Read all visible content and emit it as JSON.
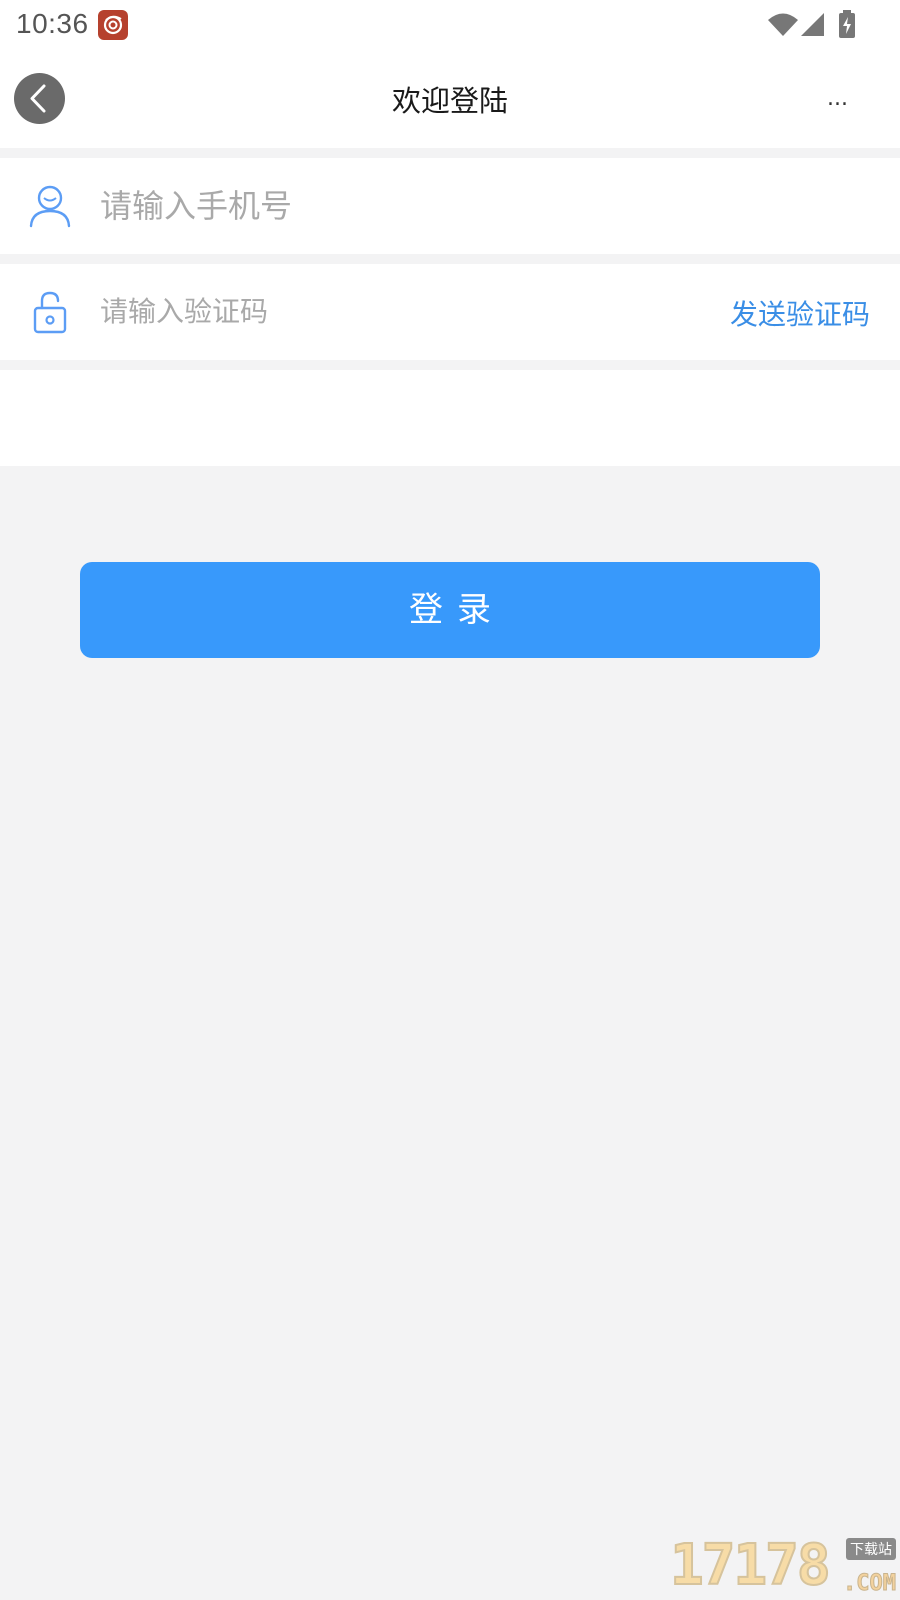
{
  "status_bar": {
    "time": "10:36"
  },
  "nav": {
    "title": "欢迎登陆",
    "more_label": "..."
  },
  "phone_field": {
    "placeholder": "请输入手机号",
    "value": ""
  },
  "code_field": {
    "placeholder": "请输入验证码",
    "value": "",
    "send_label": "发送验证码"
  },
  "login_button": {
    "label": "登录"
  },
  "watermark": {
    "main": "17178",
    "badge": "下载站",
    "suffix": ".COM"
  },
  "colors": {
    "accent": "#3899fb",
    "link": "#3a8ee6",
    "icon_blue": "#5c9df5",
    "page_bg": "#f3f3f4"
  },
  "icons": [
    "app-notification-icon",
    "wifi-icon",
    "cellular-signal-icon",
    "battery-charging-icon",
    "back-arrow-icon",
    "user-icon",
    "unlock-icon"
  ]
}
